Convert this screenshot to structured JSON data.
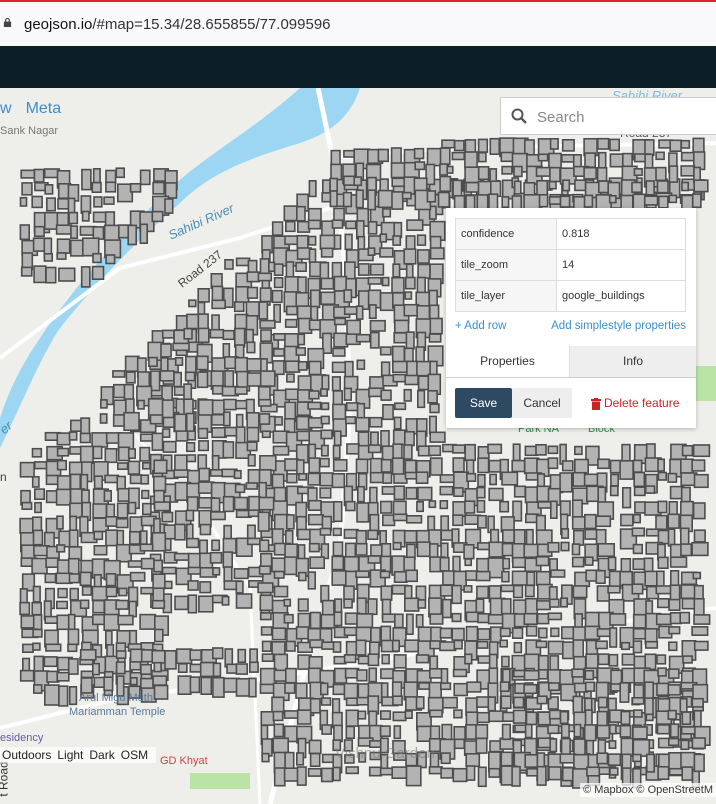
{
  "browser": {
    "url_domain": "geojson.io",
    "url_path": "/#map=15.34/28.655855/77.099596"
  },
  "nav_tabs": [
    "w",
    "Meta"
  ],
  "search": {
    "placeholder": "Search"
  },
  "map_labels": {
    "nagar": "Sank Nagar",
    "road237_top": "Road 237",
    "road237": "Road 237",
    "river_top": "Sahibi River",
    "river_mid": "Sahibi River",
    "river_left": "er",
    "temple_line1": "Arul Migu Muth",
    "temple_line2": "Mariamman Temple",
    "residency": "esidency",
    "gd": "GD Khyat",
    "park": "Park NA",
    "block": "Block",
    "road_left": "t Road",
    "vishnu": "Vishnu Garden",
    "left_edge": "n"
  },
  "popup": {
    "properties": [
      {
        "key": "confidence",
        "value": "0.818"
      },
      {
        "key": "tile_zoom",
        "value": "14"
      },
      {
        "key": "tile_layer",
        "value": "google_buildings"
      }
    ],
    "add_row": "+ Add row",
    "add_simplestyle": "Add simplestyle properties",
    "tab_properties": "Properties",
    "tab_info": "Info",
    "save": "Save",
    "cancel": "Cancel",
    "delete": "Delete feature"
  },
  "map_styles": [
    "Outdoors",
    "Light",
    "Dark",
    "OSM"
  ],
  "attribution": "© Mapbox © OpenStreetM",
  "colors": {
    "accent": "#3a8fd1",
    "water": "#9dd6f2",
    "building_fill": "#b3b3b3",
    "building_stroke": "#4d4d4d",
    "header": "#0c1f29",
    "save": "#2e4a62",
    "delete": "#cc2222"
  }
}
